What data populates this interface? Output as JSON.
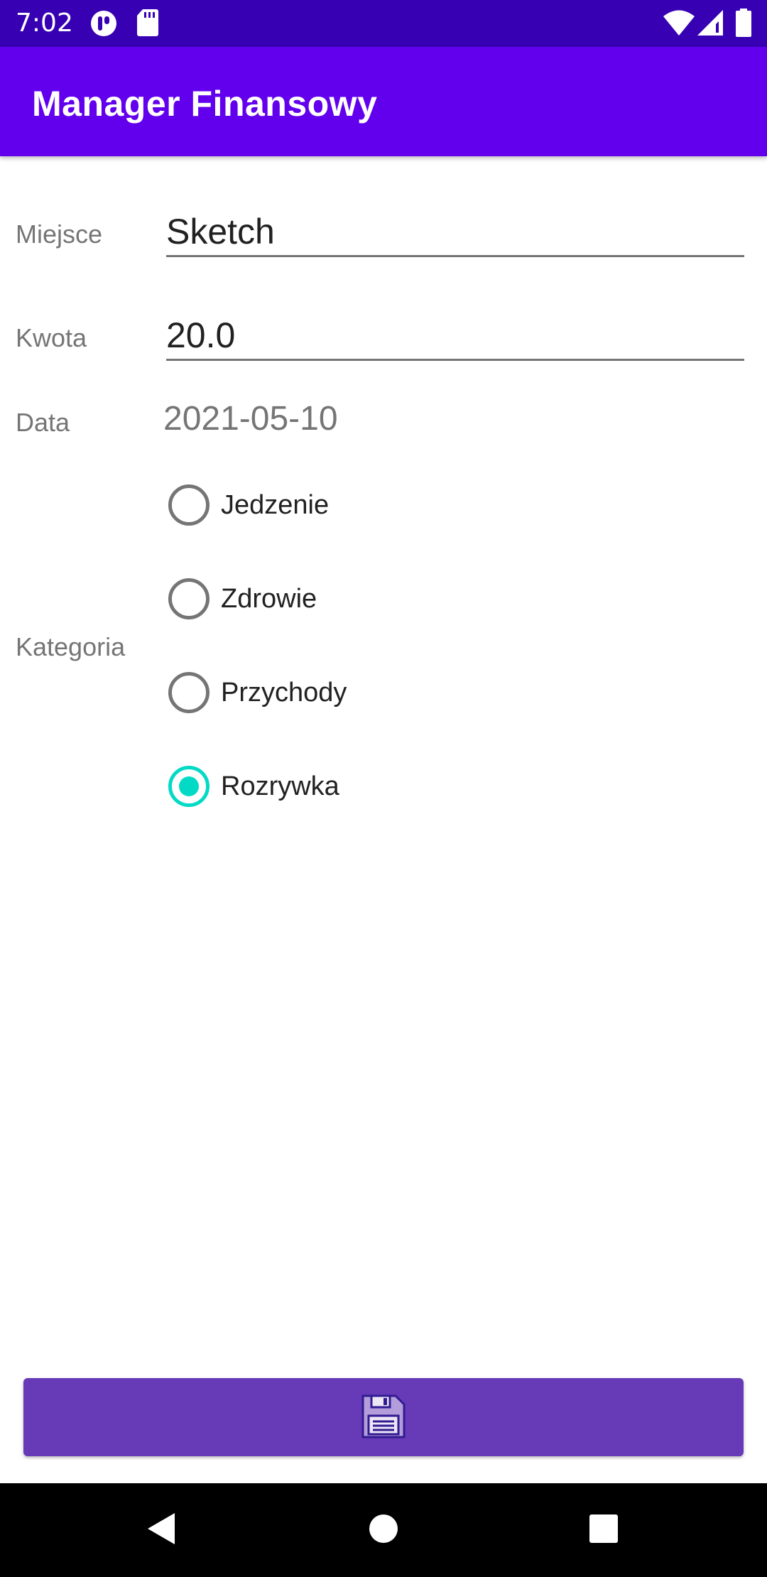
{
  "status_bar": {
    "time": "7:02",
    "icons": [
      "app-notification-icon",
      "sd-card-icon",
      "wifi-icon",
      "signal-icon",
      "battery-icon"
    ]
  },
  "app_bar": {
    "title": "Manager Finansowy"
  },
  "form": {
    "place": {
      "label": "Miejsce",
      "value": "Sketch"
    },
    "amount": {
      "label": "Kwota",
      "value": "20.0"
    },
    "date": {
      "label": "Data",
      "value": "2021-05-10"
    },
    "category": {
      "label": "Kategoria",
      "options": [
        {
          "label": "Jedzenie",
          "checked": false
        },
        {
          "label": "Zdrowie",
          "checked": false
        },
        {
          "label": "Przychody",
          "checked": false
        },
        {
          "label": "Rozrywka",
          "checked": true
        }
      ]
    }
  },
  "save_button": {
    "icon": "save-icon"
  },
  "nav": {
    "back": "back-icon",
    "home": "home-icon",
    "recents": "recents-icon"
  },
  "colors": {
    "status_bar": "#3700b3",
    "app_bar": "#6200ee",
    "button": "#673ab7",
    "radio_checked": "#03dac5"
  }
}
